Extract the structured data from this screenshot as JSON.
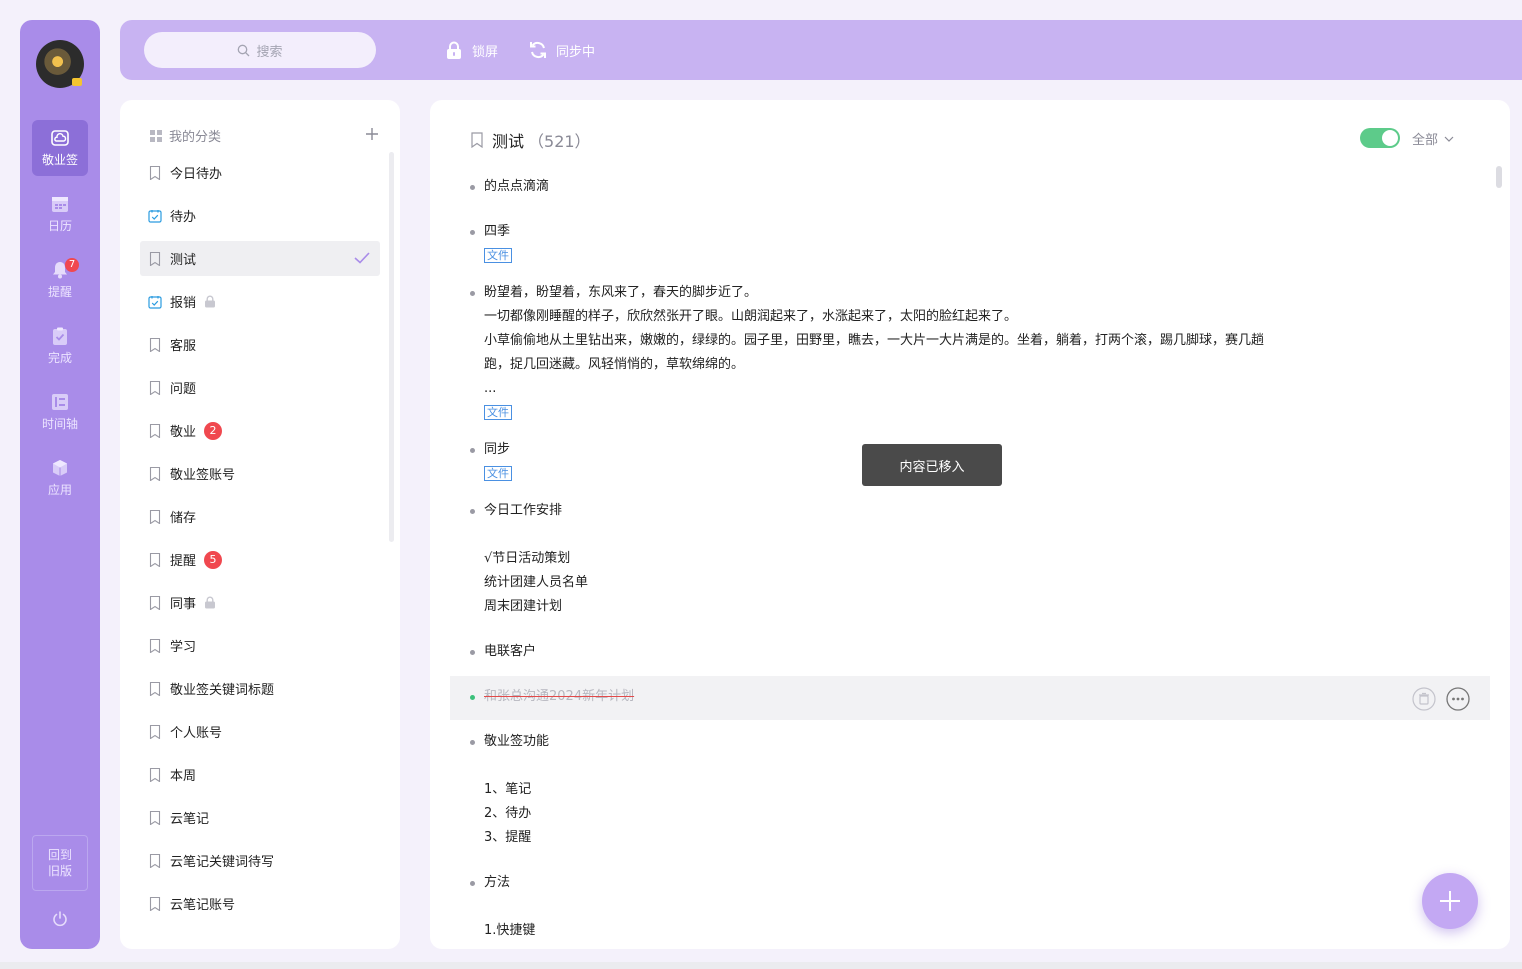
{
  "colors": {
    "rail": "#a98ce9",
    "rail_active": "#8c6fd8",
    "topbar": "#c8b3f2",
    "badge": "#f0484f",
    "toggle_on": "#5dcb8a",
    "file_tag": "#4a90e2",
    "done_bullet": "#3cc07a"
  },
  "rail": {
    "items": [
      {
        "label": "敬业签",
        "icon": "note-cloud-icon"
      },
      {
        "label": "日历",
        "icon": "calendar-icon"
      },
      {
        "label": "提醒",
        "icon": "bell-icon",
        "badge": "7"
      },
      {
        "label": "完成",
        "icon": "done-clipboard-icon"
      },
      {
        "label": "时间轴",
        "icon": "timeline-icon"
      },
      {
        "label": "应用",
        "icon": "cube-icon"
      }
    ],
    "old_version": "回到旧版",
    "power_icon": "power-icon"
  },
  "topbar": {
    "search_placeholder": "搜索",
    "lock_label": "锁屏",
    "sync_label": "同步中"
  },
  "categories": {
    "header": "我的分类",
    "items": [
      {
        "label": "今日待办",
        "icon": "bookmark-icon"
      },
      {
        "label": "待办",
        "icon": "calendar-check-icon"
      },
      {
        "label": "测试",
        "icon": "bookmark-icon",
        "active": true
      },
      {
        "label": "报销",
        "icon": "calendar-check-icon",
        "locked": true
      },
      {
        "label": "客服",
        "icon": "bookmark-icon"
      },
      {
        "label": "问题",
        "icon": "bookmark-icon"
      },
      {
        "label": "敬业",
        "icon": "bookmark-icon",
        "badge": "2"
      },
      {
        "label": "敬业签账号",
        "icon": "bookmark-icon"
      },
      {
        "label": "储存",
        "icon": "bookmark-icon"
      },
      {
        "label": "提醒",
        "icon": "bookmark-icon",
        "badge": "5"
      },
      {
        "label": "同事",
        "icon": "bookmark-icon",
        "locked": true
      },
      {
        "label": "学习",
        "icon": "bookmark-icon"
      },
      {
        "label": "敬业签关键词标题",
        "icon": "bookmark-icon"
      },
      {
        "label": "个人账号",
        "icon": "bookmark-icon"
      },
      {
        "label": "本周",
        "icon": "bookmark-icon"
      },
      {
        "label": "云笔记",
        "icon": "bookmark-icon"
      },
      {
        "label": "云笔记关键词待写",
        "icon": "bookmark-icon"
      },
      {
        "label": "云笔记账号",
        "icon": "bookmark-icon"
      }
    ]
  },
  "main": {
    "title": "测试",
    "count": "（521）",
    "filter_label": "全部",
    "toggle_on": true,
    "file_label": "文件",
    "notes": [
      {
        "lines": [
          "的点点滴滴"
        ]
      },
      {
        "lines": [
          "四季"
        ],
        "file": true
      },
      {
        "lines": [
          "盼望着，盼望着，东风来了，春天的脚步近了。",
          "一切都像刚睡醒的样子，欣欣然张开了眼。山朗润起来了，水涨起来了，太阳的脸红起来了。",
          "小草偷偷地从土里钻出来，嫩嫩的，绿绿的。园子里，田野里，瞧去，一大片一大片满是的。坐着，躺着，打两个滚，踢几脚球，赛几趟",
          "跑，捉几回迷藏。风轻悄悄的，草软绵绵的。",
          "..."
        ],
        "file": true
      },
      {
        "lines": [
          "同步"
        ],
        "file": true
      },
      {
        "lines": [
          "今日工作安排",
          "",
          "√节日活动策划",
          "统计团建人员名单",
          "周末团建计划"
        ]
      },
      {
        "lines": [
          "电联客户"
        ]
      },
      {
        "lines": [
          "和张总沟通2024新年计划"
        ],
        "done": true
      },
      {
        "lines": [
          "敬业签功能",
          "",
          "1、笔记",
          "2、待办",
          "3、提醒"
        ]
      },
      {
        "lines": [
          "方法",
          "",
          "1.快捷键"
        ]
      }
    ]
  },
  "toast": "内容已移入"
}
